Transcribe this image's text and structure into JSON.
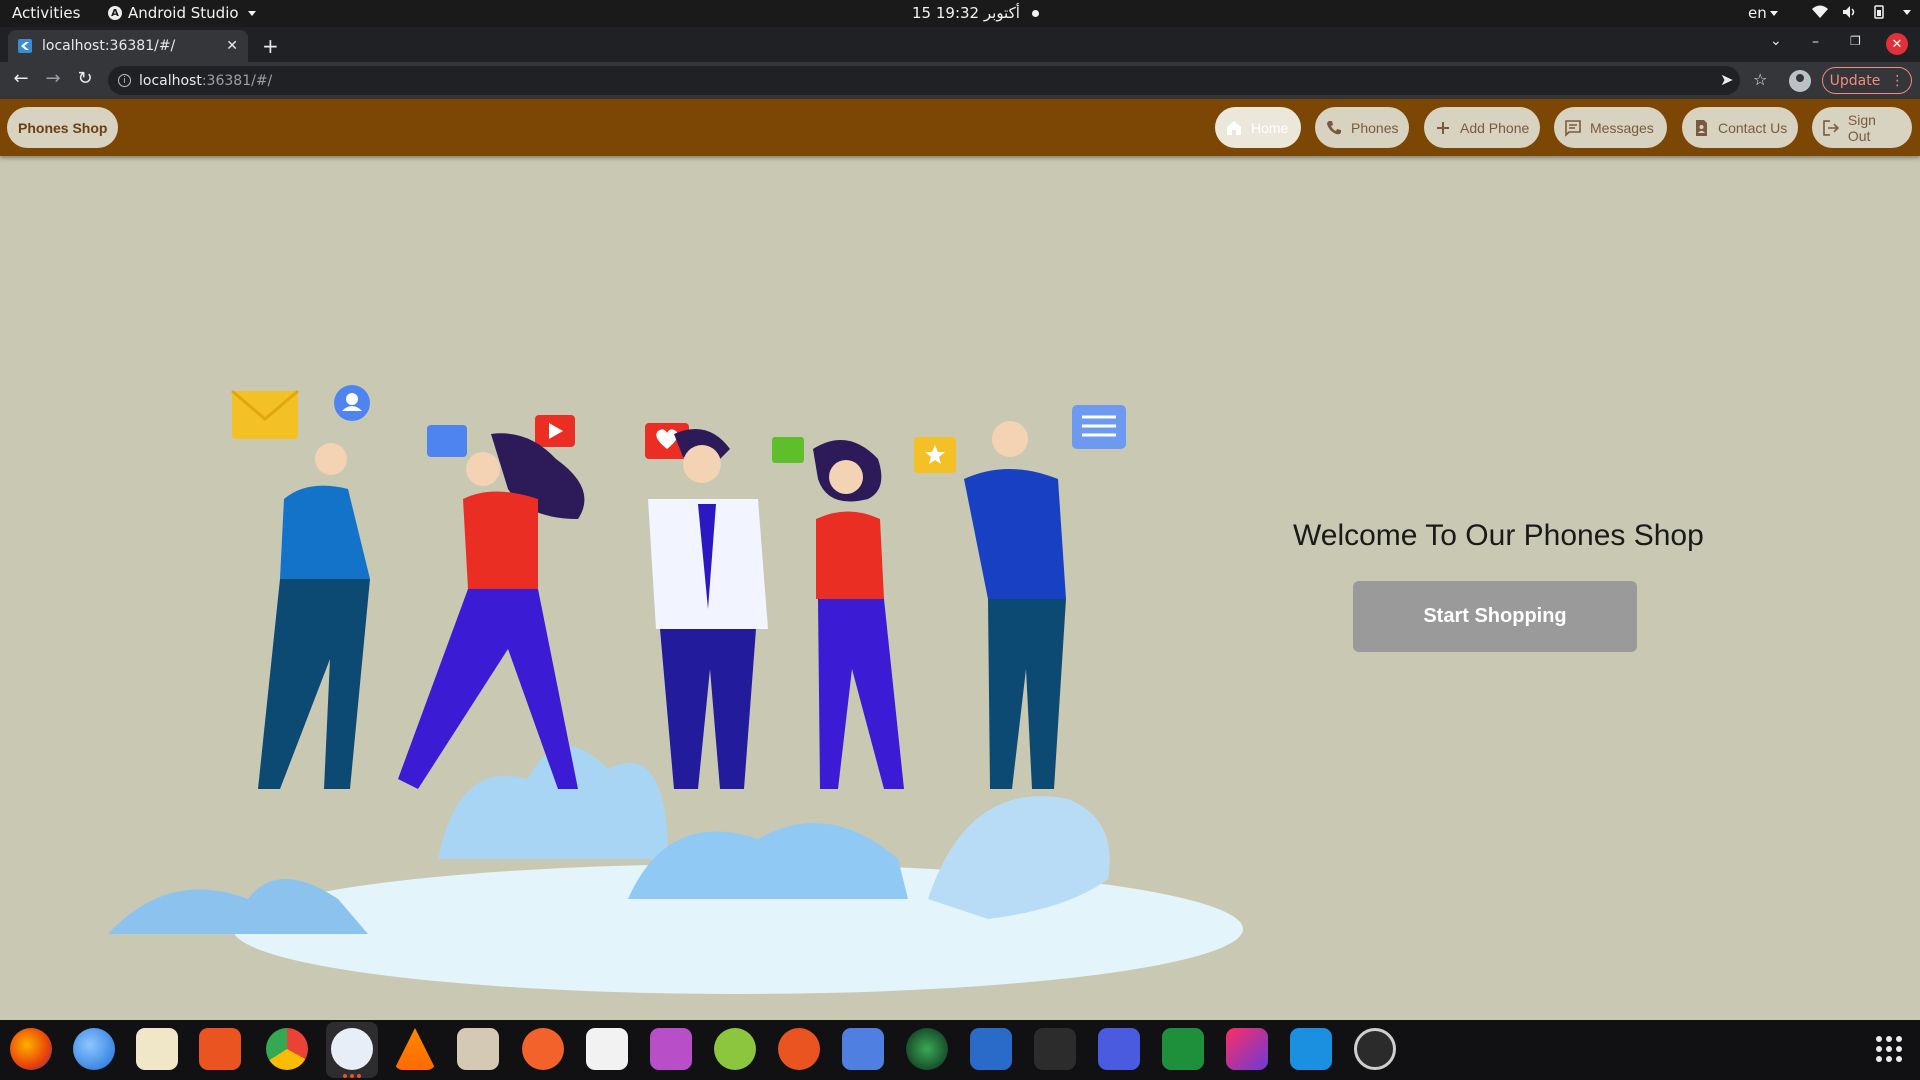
{
  "system_bar": {
    "activities": "Activities",
    "app_name": "Android Studio",
    "clock": "15 أكتوبر  19:32",
    "language": "en"
  },
  "browser": {
    "tab_title": "localhost:36381/#/",
    "url_host": "localhost",
    "url_path": ":36381/#/",
    "update_label": "Update"
  },
  "app": {
    "brand": "Phones Shop",
    "nav": [
      {
        "label": "Home",
        "icon": "home-icon",
        "active": true
      },
      {
        "label": "Phones",
        "icon": "phone-icon",
        "active": false
      },
      {
        "label": "Add Phone",
        "icon": "plus-icon",
        "active": false
      },
      {
        "label": "Messages",
        "icon": "message-icon",
        "active": false
      },
      {
        "label": "Contact Us",
        "icon": "contact-icon",
        "active": false
      },
      {
        "label": "Sign Out",
        "icon": "sign-out-icon",
        "active": false
      }
    ],
    "welcome": "Welcome To Our Phones Shop",
    "cta": "Start Shopping"
  },
  "colors": {
    "appbar": "#7c4604",
    "background": "#c9c8b2",
    "nav_button": "#d8d2c1",
    "cta": "#999a99"
  },
  "dock": {
    "apps": [
      "firefox",
      "thunderbird",
      "rhythmbox",
      "software-center",
      "chrome",
      "android-studio",
      "vlc",
      "files",
      "inkscape",
      "document-viewer",
      "video-player",
      "disk-manager",
      "ubuntu",
      "todo",
      "camera",
      "writer",
      "terminal",
      "screenshot",
      "calc",
      "intellij",
      "vscode",
      "updater"
    ]
  }
}
